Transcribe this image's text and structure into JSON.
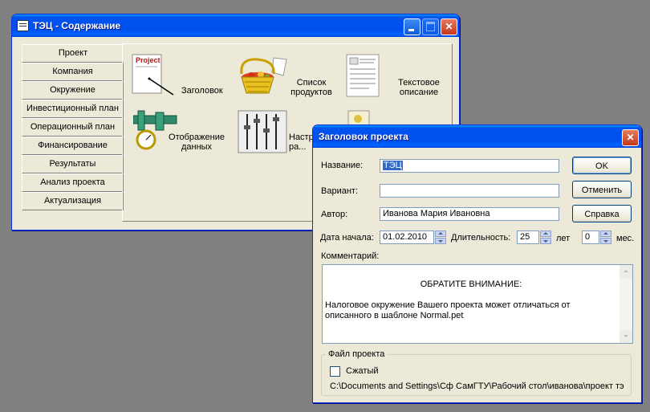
{
  "main_window": {
    "title": "ТЭЦ - Содержание",
    "nav_items": [
      "Проект",
      "Компания",
      "Окружение",
      "Инвестиционный план",
      "Операционный план",
      "Финансирование",
      "Результаты",
      "Анализ проекта",
      "Актуализация"
    ],
    "tiles": {
      "header_label": "Заголовок",
      "header_icon_caption": "Project",
      "products_label": "Список продуктов",
      "text_desc_label": "Текстовое описание",
      "display_label": "Отображение данных",
      "settings_label": "Настр... ра..."
    }
  },
  "dialog": {
    "title": "Заголовок проекта",
    "name_label": "Название:",
    "name_value": "ТЭЦ",
    "variant_label": "Вариант:",
    "variant_value": "",
    "author_label": "Автор:",
    "author_value": "Иванова Мария Ивановна",
    "start_label": "Дата начала:",
    "start_value": "01.02.2010",
    "duration_label": "Длительность:",
    "duration_years": "25",
    "years_unit": "лет",
    "duration_months": "0",
    "months_unit": "мес.",
    "comment_label": "Комментарий:",
    "comment_heading": "ОБРАТИТЕ ВНИМАНИЕ:",
    "comment_body": "Налоговое окружение Вашего проекта может отличаться от описанного в шаблоне Normal.pet",
    "ok_label": "OK",
    "cancel_label": "Отменить",
    "help_label": "Справка",
    "file_group_label": "Файл проекта",
    "compressed_label": "Сжатый",
    "compressed_checked": false,
    "file_path": "C:\\Documents and Settings\\Сф СамГТУ\\Рабочий стол\\иванова\\проект тэ"
  },
  "colors": {
    "desktop": "#808080",
    "window_face": "#ece9d8",
    "titlebar_blue": "#0053ee",
    "selection": "#316ac5"
  }
}
